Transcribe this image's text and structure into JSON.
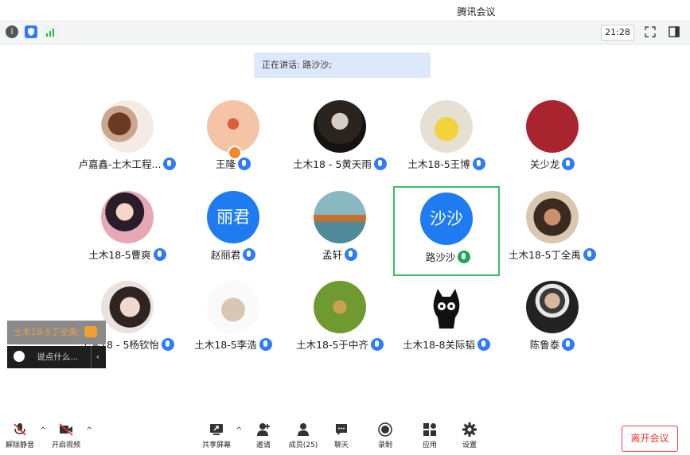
{
  "window": {
    "title": "腾讯会议"
  },
  "toolbar": {
    "time": "21:28"
  },
  "speaker": {
    "text": "正在讲话: 路沙沙;"
  },
  "participants": [
    {
      "name": "卢嘉鑫-土木工程..."
    },
    {
      "name": "王隆"
    },
    {
      "name": "土木18 - 5黄天雨"
    },
    {
      "name": "土木18-5王博"
    },
    {
      "name": "关少龙"
    },
    {
      "name": "土木18-5曹爽"
    },
    {
      "name": "赵丽君",
      "avatar_text": "丽君"
    },
    {
      "name": "孟轩"
    },
    {
      "name": "路沙沙",
      "avatar_text": "沙沙"
    },
    {
      "name": "土木18-5丁全禹"
    },
    {
      "name": "土木18 - 5杨钦怡"
    },
    {
      "name": "土木18-5李浩"
    },
    {
      "name": "土木18-5于中齐"
    },
    {
      "name": "土木18-8关际韬"
    },
    {
      "name": "陈鲁泰"
    }
  ],
  "chat": {
    "popup": "土木18-5丁全禹:",
    "placeholder": "说点什么..."
  },
  "bottom_bar": {
    "mute": "解除静音",
    "video": "开启视频",
    "share": "共享屏幕",
    "invite": "邀请",
    "members": "成员(25)",
    "chat": "聊天",
    "record": "录制",
    "apps": "应用",
    "settings": "设置",
    "leave": "离开会议"
  },
  "colors": {
    "accent": "#1e7cf0",
    "leave": "#e33333",
    "active_border": "#3cbf62"
  }
}
